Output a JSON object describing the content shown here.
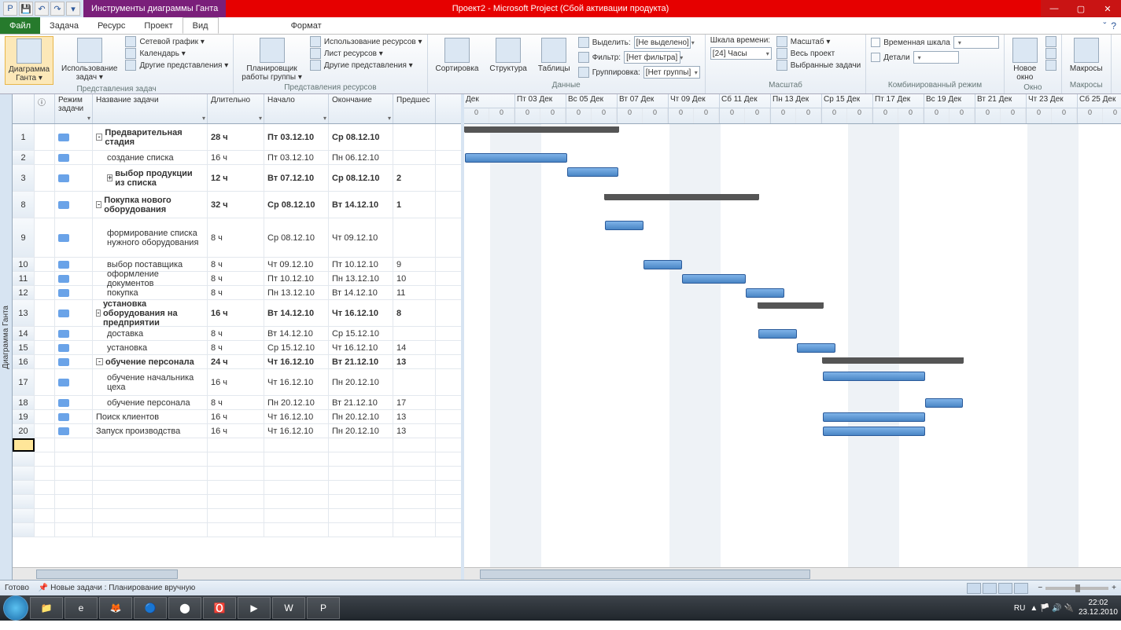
{
  "titlebar": {
    "tool_tab": "Инструменты диаграммы Ганта",
    "app_title": "Проект2 - Microsoft Project (Сбой активации продукта)"
  },
  "tabs": {
    "file": "Файл",
    "task": "Задача",
    "resource": "Ресурс",
    "project": "Проект",
    "view": "Вид",
    "format": "Формат"
  },
  "ribbon": {
    "gantt_btn": "Диаграмма\nГанта ▾",
    "usage_btn": "Использование\nзадач ▾",
    "net": "Сетевой график ▾",
    "cal": "Календарь ▾",
    "other1": "Другие представления ▾",
    "g1": "Представления задач",
    "plan_btn": "Планировщик\nработы группы ▾",
    "res_use": "Использование ресурсов ▾",
    "res_sheet": "Лист ресурсов ▾",
    "other2": "Другие представления ▾",
    "g2": "Представления ресурсов",
    "sort": "Сортировка",
    "struct": "Структура",
    "tables": "Таблицы",
    "highlight": "Выделить:",
    "filter": "Фильтр:",
    "group": "Группировка:",
    "hl_val": "[Не выделено]",
    "fl_val": "[Нет фильтра]",
    "gr_val": "[Нет группы]",
    "g3": "Данные",
    "timescale": "Шкала времени:",
    "ts_val": "[24] Часы",
    "zoom": "Масштаб ▾",
    "whole": "Весь проект",
    "selected": "Выбранные задачи",
    "g4": "Масштаб",
    "timeline": "Временная шкала",
    "details": "Детали",
    "g5": "Комбинированный режим",
    "newwin": "Новое\nокно",
    "g6": "Окно",
    "macros": "Макросы",
    "g7": "Макросы"
  },
  "columns": {
    "info": "ⓘ",
    "mode": "Режим\nзадачи",
    "name": "Название задачи",
    "dur": "Длительно",
    "start": "Начало",
    "end": "Окончание",
    "pred": "Предшес"
  },
  "tasks": [
    {
      "n": "1",
      "name": "Предварительная стадия",
      "dur": "28 ч",
      "start": "Пт 03.12.10",
      "end": "Ср 08.12.10",
      "pred": "",
      "bold": true,
      "indent": 0,
      "exp": "-"
    },
    {
      "n": "2",
      "name": "создание списка",
      "dur": "16 ч",
      "start": "Пт 03.12.10",
      "end": "Пн 06.12.10",
      "pred": "",
      "bold": false,
      "indent": 1
    },
    {
      "n": "3",
      "name": "выбор продукции из списка",
      "dur": "12 ч",
      "start": "Вт 07.12.10",
      "end": "Ср 08.12.10",
      "pred": "2",
      "bold": true,
      "indent": 1,
      "exp": "+"
    },
    {
      "n": "8",
      "name": "Покупка нового оборудования",
      "dur": "32 ч",
      "start": "Ср 08.12.10",
      "end": "Вт 14.12.10",
      "pred": "1",
      "bold": true,
      "indent": 0,
      "exp": "-"
    },
    {
      "n": "9",
      "name": "формирование списка нужного оборудования",
      "dur": "8 ч",
      "start": "Ср 08.12.10",
      "end": "Чт 09.12.10",
      "pred": "",
      "bold": false,
      "indent": 1
    },
    {
      "n": "10",
      "name": "выбор поставщика",
      "dur": "8 ч",
      "start": "Чт 09.12.10",
      "end": "Пт 10.12.10",
      "pred": "9",
      "bold": false,
      "indent": 1
    },
    {
      "n": "11",
      "name": "оформление документов",
      "dur": "8 ч",
      "start": "Пт 10.12.10",
      "end": "Пн 13.12.10",
      "pred": "10",
      "bold": false,
      "indent": 1
    },
    {
      "n": "12",
      "name": "покупка",
      "dur": "8 ч",
      "start": "Пн 13.12.10",
      "end": "Вт 14.12.10",
      "pred": "11",
      "bold": false,
      "indent": 1
    },
    {
      "n": "13",
      "name": "установка оборудования на предприятии",
      "dur": "16 ч",
      "start": "Вт 14.12.10",
      "end": "Чт 16.12.10",
      "pred": "8",
      "bold": true,
      "indent": 0,
      "exp": "-"
    },
    {
      "n": "14",
      "name": "доставка",
      "dur": "8 ч",
      "start": "Вт 14.12.10",
      "end": "Ср 15.12.10",
      "pred": "",
      "bold": false,
      "indent": 1
    },
    {
      "n": "15",
      "name": "установка",
      "dur": "8 ч",
      "start": "Ср 15.12.10",
      "end": "Чт 16.12.10",
      "pred": "14",
      "bold": false,
      "indent": 1
    },
    {
      "n": "16",
      "name": "обучение персонала",
      "dur": "24 ч",
      "start": "Чт 16.12.10",
      "end": "Вт 21.12.10",
      "pred": "13",
      "bold": true,
      "indent": 0,
      "exp": "-"
    },
    {
      "n": "17",
      "name": "обучение начальника цеха",
      "dur": "16 ч",
      "start": "Чт 16.12.10",
      "end": "Пн 20.12.10",
      "pred": "",
      "bold": false,
      "indent": 1
    },
    {
      "n": "18",
      "name": "обучение персонала",
      "dur": "8 ч",
      "start": "Пн 20.12.10",
      "end": "Вт 21.12.10",
      "pred": "17",
      "bold": false,
      "indent": 1
    },
    {
      "n": "19",
      "name": "Поиск клиентов",
      "dur": "16 ч",
      "start": "Чт 16.12.10",
      "end": "Пн 20.12.10",
      "pred": "13",
      "bold": false,
      "indent": 0
    },
    {
      "n": "20",
      "name": "Запуск производства",
      "dur": "16 ч",
      "start": "Чт 16.12.10",
      "end": "Пн 20.12.10",
      "pred": "13",
      "bold": false,
      "indent": 0
    }
  ],
  "timeline_days": [
    "Дек",
    "Пт 03 Дек",
    "Вс 05 Дек",
    "Вт 07 Дек",
    "Чт 09 Дек",
    "Сб 11 Дек",
    "Пн 13 Дек",
    "Ср 15 Дек",
    "Пт 17 Дек",
    "Вс 19 Дек",
    "Вт 21 Дек",
    "Чт 23 Дек",
    "Сб 25 Дек"
  ],
  "side": "Диаграмма Ганта",
  "status": {
    "ready": "Готово",
    "newtasks": "Новые задачи : Планирование вручную"
  },
  "tray": {
    "lang": "RU",
    "time": "22:02",
    "date": "23.12.2010"
  }
}
